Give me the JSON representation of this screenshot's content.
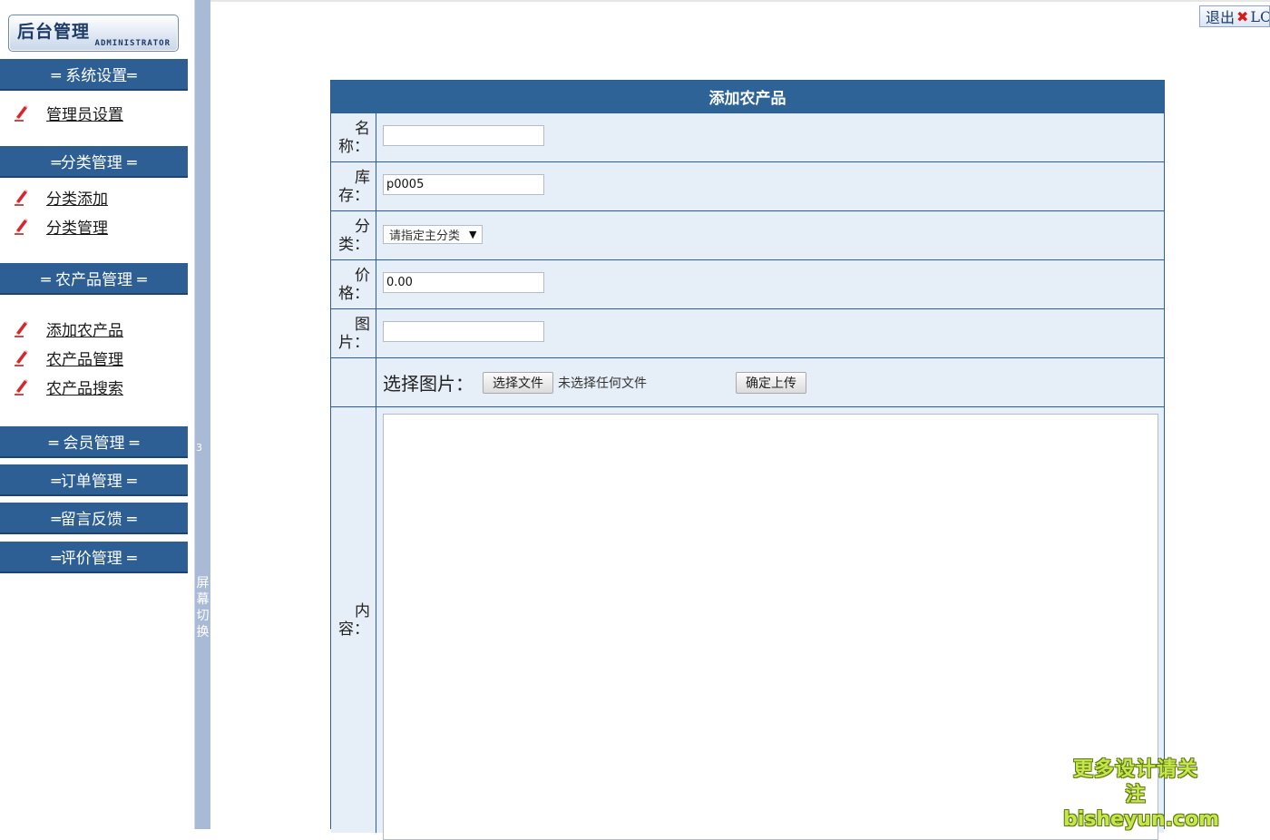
{
  "logo": {
    "title": "后台管理",
    "subtitle": "ADMINISTRATOR"
  },
  "logout": {
    "label": "退出",
    "suffix": "LOG"
  },
  "sidebar": {
    "sections": [
      {
        "title": "═ 系统设置═",
        "items": [
          "管理员设置"
        ]
      },
      {
        "title": "═分类管理 ═",
        "items": [
          "分类添加",
          "分类管理"
        ]
      },
      {
        "title": "═ 农产品管理 ═",
        "items": [
          "添加农产品",
          "农产品管理",
          "农产品搜索"
        ]
      },
      {
        "title": "═ 会员管理 ═",
        "items": []
      },
      {
        "title": "═订单管理 ═",
        "items": []
      },
      {
        "title": "═留言反馈 ═",
        "items": []
      },
      {
        "title": "═评价管理 ═",
        "items": []
      }
    ]
  },
  "splitter": {
    "number": "3",
    "label": "屏幕切换"
  },
  "form": {
    "title": "添加农产品",
    "fields": {
      "name": {
        "label1": "名",
        "label2": "称：",
        "value": ""
      },
      "stock": {
        "label1": "库",
        "label2": "存：",
        "value": "p0005"
      },
      "category": {
        "label1": "分",
        "label2": "类：",
        "selected": "请指定主分类"
      },
      "price": {
        "label1": "价",
        "label2": "格：",
        "value": "0.00"
      },
      "image": {
        "label1": "图",
        "label2": "片：",
        "value": ""
      },
      "content": {
        "label1": "内",
        "label2": "容："
      }
    },
    "upload": {
      "label": "选择图片：",
      "choose_button": "选择文件",
      "no_file_text": "未选择任何文件",
      "submit_button": "确定上传"
    }
  },
  "watermark": {
    "line1": "更多设计请关注",
    "line2": "bisheyun.com"
  },
  "colors": {
    "header_blue": "#2d5f94",
    "row_bg": "#e6eef8",
    "splitter": "#a9bad6",
    "close_red": "#d51a1a"
  },
  "icons": {
    "menu_item": "pencil-icon",
    "logout": "close-icon"
  }
}
